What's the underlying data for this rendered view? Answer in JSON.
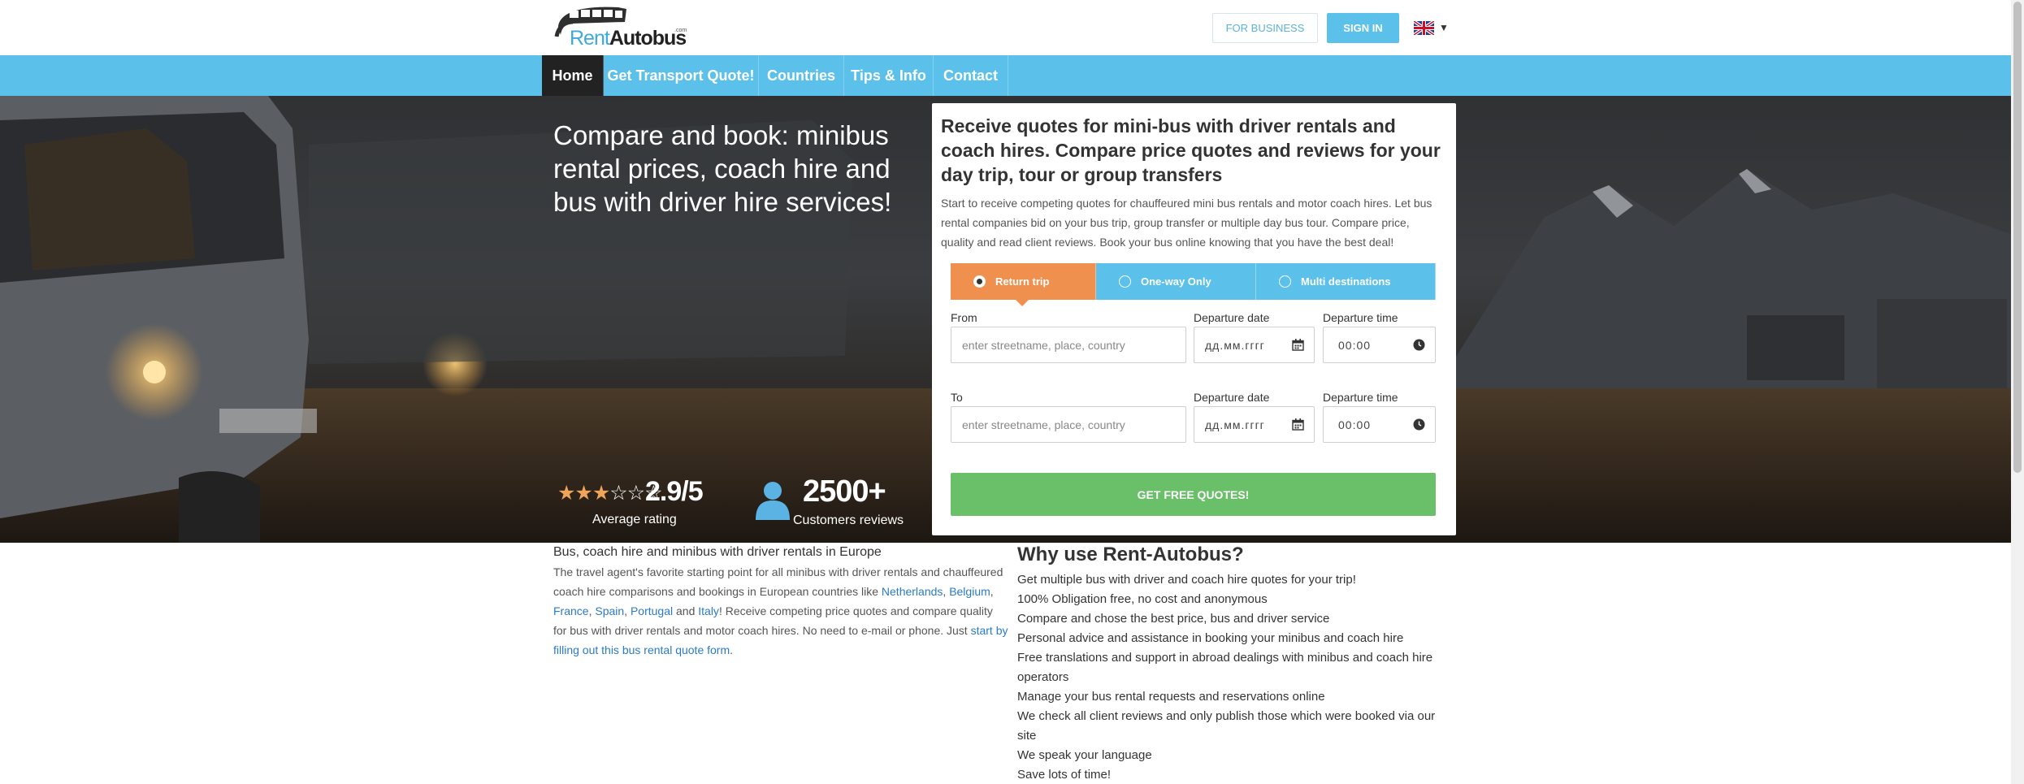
{
  "header": {
    "logo": {
      "part1": "Rent",
      "part2": "Autobus",
      "suffix": ".com"
    },
    "for_business": "FOR BUSINESS",
    "sign_in": "SIGN IN",
    "language_icon": "uk-flag-icon"
  },
  "nav": {
    "items": [
      {
        "label": "Home",
        "active": true
      },
      {
        "label": "Get Transport Quote!"
      },
      {
        "label": "Countries"
      },
      {
        "label": "Tips & Info"
      },
      {
        "label": "Contact"
      }
    ]
  },
  "hero": {
    "title": "Compare and book: minibus rental prices, coach hire and bus with driver hire services!",
    "rating": {
      "value": "2.9/5",
      "label": "Average rating",
      "stars_filled": 3,
      "stars_total": 6
    },
    "reviews": {
      "count": "2500+",
      "label": "Customers reviews"
    }
  },
  "quote_form": {
    "title": "Receive quotes for mini-bus with driver rentals and coach hires. Compare price quotes and reviews for your day trip, tour or group transfers",
    "description": "Start to receive competing quotes for chauffeured mini bus rentals and motor coach hires. Let bus rental companies bid on your bus trip, group transfer or multiple day bus tour. Compare price, quality and read client reviews. Book your bus online knowing that you have the best deal!",
    "trip_types": [
      {
        "label": "Return trip",
        "selected": true
      },
      {
        "label": "One-way Only"
      },
      {
        "label": "Multi destinations"
      }
    ],
    "from": {
      "label": "From",
      "placeholder": "enter streetname, place, country"
    },
    "to": {
      "label": "To",
      "placeholder": "enter streetname, place, country"
    },
    "departure_date_label": "Departure date",
    "departure_time_label": "Departure time",
    "date_placeholder": "дд.мм.гггг",
    "time_value": "00:00",
    "submit": "GET FREE QUOTES!"
  },
  "intro": {
    "heading": "Bus, coach hire and minibus with driver rentals in Europe",
    "text1": "The travel agent's favorite starting point for all minibus with driver rentals and chauffeured coach hire comparisons and bookings in European countries like ",
    "countries": [
      "Netherlands",
      "Belgium",
      "France",
      "Spain",
      "Portugal"
    ],
    "and": " and ",
    "country_last": "Italy",
    "text2": "! Receive competing price quotes and compare quality for bus with driver rentals and motor coach hires. No need to e-mail or phone. Just ",
    "cta_link": "start by filling out this bus rental quote form",
    "end": "."
  },
  "why": {
    "heading": "Why use Rent-Autobus?",
    "items": [
      "Get multiple bus with driver and coach hire quotes for your trip!",
      "100% Obligation free, no cost and anonymous",
      "Compare and chose the best price, bus and driver service",
      "Personal advice and assistance in booking your minibus and coach hire",
      "Free translations and support in abroad dealings with minibus and coach hire operators",
      "Manage your bus rental requests and reservations online",
      "We check all client reviews and only publish those which were booked via our site",
      "We speak your language",
      "Save lots of time!"
    ]
  },
  "colors": {
    "nav_blue": "#5bc0ea",
    "nav_active": "#222222",
    "accent_orange": "#f0904e",
    "cta_green": "#6abf69",
    "link_blue": "#2b7bc4"
  }
}
